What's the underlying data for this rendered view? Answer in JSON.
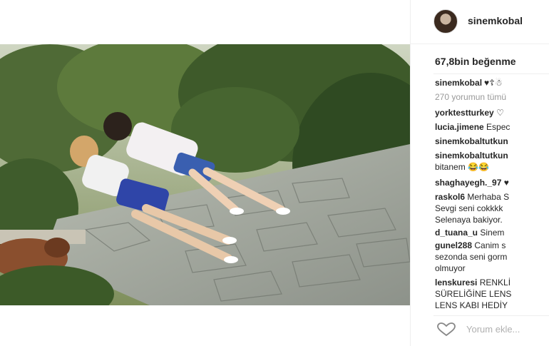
{
  "post": {
    "username": "sinemkobal",
    "likes": "67,8bin beğenme",
    "caption_user": "sinemkobal",
    "caption_icons": "♥☦☃",
    "load_more": "270 yorumun tümü"
  },
  "comments": [
    {
      "user": "yorktestturkey",
      "text": "♡"
    },
    {
      "user": "lucia.jimene",
      "text": "Espec"
    },
    {
      "user": "sinemkobaltutkun",
      "text": ""
    },
    {
      "user": "sinemkobaltutkun",
      "text": ""
    },
    {
      "user": "",
      "text": "bitanem 😂😂"
    },
    {
      "user": "shaghayegh._97",
      "text": "♥"
    },
    {
      "user": "raskol6",
      "text": "Merhaba S"
    },
    {
      "user": "",
      "text": "Sevgi seni cokkkk"
    },
    {
      "user": "",
      "text": "Selenaya bakiyor."
    },
    {
      "user": "d_tuana_u",
      "text": "Sinem"
    },
    {
      "user": "gunel288",
      "text": "Canim s"
    },
    {
      "user": "",
      "text": "sezonda seni gorm"
    },
    {
      "user": "",
      "text": "olmuyor"
    },
    {
      "user": "lenskuresi",
      "text": "RENKLİ"
    },
    {
      "user": "",
      "text": "SÜRELİĞİNE LENS"
    },
    {
      "user": "",
      "text": "LENS KABI HEDİY"
    }
  ],
  "footer": {
    "add_comment_placeholder": "Yorum ekle..."
  },
  "icons": {
    "like": "heart-outline-icon",
    "avatar": "profile-avatar"
  }
}
